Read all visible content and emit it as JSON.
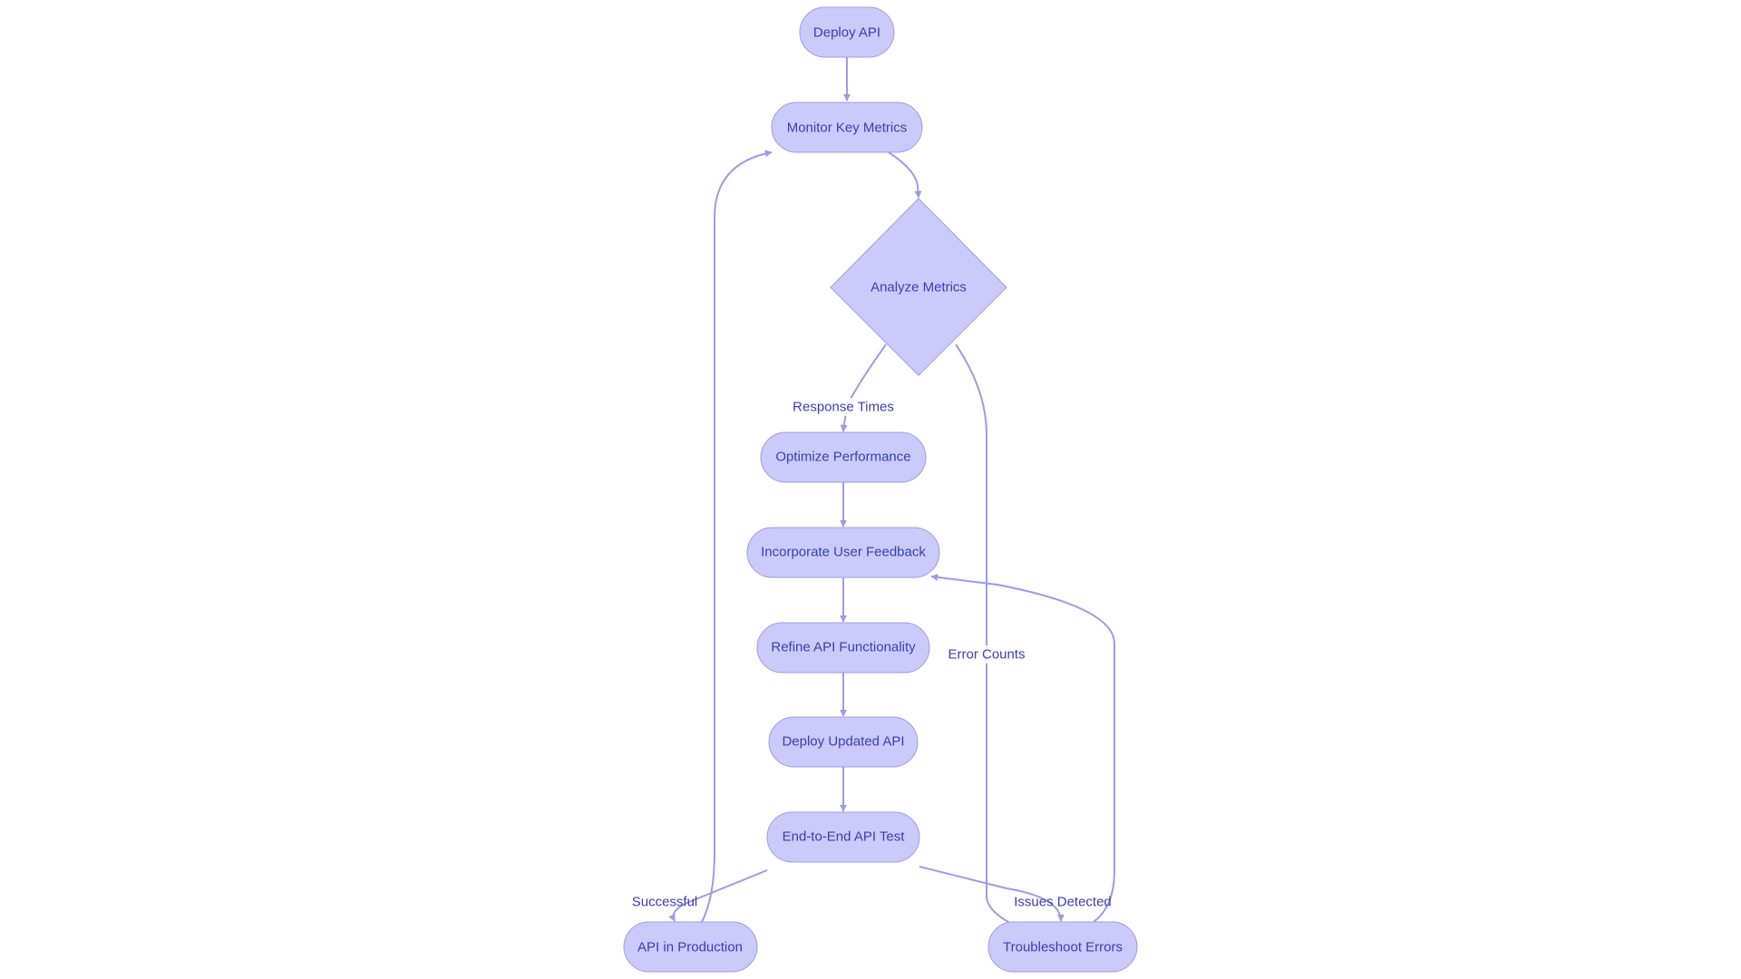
{
  "diagram": {
    "type": "flowchart",
    "colors": {
      "node_fill": "#cacafb",
      "node_stroke": "#9d9de6",
      "text": "#3d3db3",
      "edge": "#9c9ce6"
    },
    "nodes": {
      "deploy_api": {
        "label": "Deploy API",
        "shape": "stadium"
      },
      "monitor": {
        "label": "Monitor Key Metrics",
        "shape": "stadium"
      },
      "analyze": {
        "label": "Analyze Metrics",
        "shape": "diamond"
      },
      "optimize": {
        "label": "Optimize Performance",
        "shape": "stadium"
      },
      "feedback": {
        "label": "Incorporate User Feedback",
        "shape": "stadium"
      },
      "refine": {
        "label": "Refine API Functionality",
        "shape": "stadium"
      },
      "deploy_updated": {
        "label": "Deploy Updated API",
        "shape": "stadium"
      },
      "e2e": {
        "label": "End-to-End API Test",
        "shape": "stadium"
      },
      "production": {
        "label": "API in Production",
        "shape": "stadium"
      },
      "troubleshoot": {
        "label": "Troubleshoot Errors",
        "shape": "stadium"
      }
    },
    "edges": [
      {
        "from": "deploy_api",
        "to": "monitor",
        "label": ""
      },
      {
        "from": "monitor",
        "to": "analyze",
        "label": ""
      },
      {
        "from": "analyze",
        "to": "optimize",
        "label": "Response Times"
      },
      {
        "from": "analyze",
        "to": "troubleshoot",
        "label": "Error Counts"
      },
      {
        "from": "optimize",
        "to": "feedback",
        "label": ""
      },
      {
        "from": "feedback",
        "to": "refine",
        "label": ""
      },
      {
        "from": "refine",
        "to": "deploy_updated",
        "label": ""
      },
      {
        "from": "deploy_updated",
        "to": "e2e",
        "label": ""
      },
      {
        "from": "e2e",
        "to": "production",
        "label": "Successful"
      },
      {
        "from": "e2e",
        "to": "troubleshoot",
        "label": "Issues Detected"
      },
      {
        "from": "production",
        "to": "monitor",
        "label": ""
      },
      {
        "from": "troubleshoot",
        "to": "feedback",
        "label": ""
      }
    ],
    "edge_labels": {
      "response_times": "Response Times",
      "error_counts": "Error Counts",
      "successful": "Successful",
      "issues_detected": "Issues Detected"
    }
  }
}
